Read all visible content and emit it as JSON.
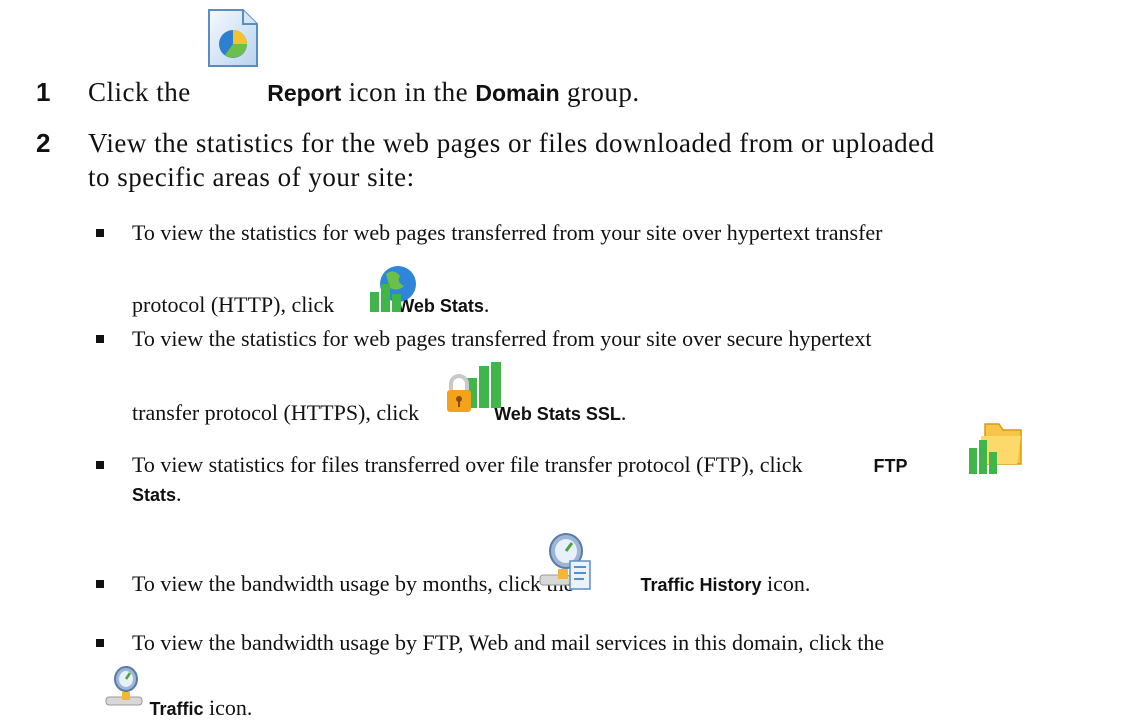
{
  "steps": [
    {
      "number": "1",
      "pre": "Click the",
      "icon": "report-icon",
      "label": "Report",
      "mid": "icon in the",
      "group": "Domain",
      "post": "group."
    },
    {
      "number": "2",
      "line1": "View the statistics for the web pages or files downloaded from or uploaded",
      "line2": "to specific areas of your site:"
    }
  ],
  "bullets": [
    {
      "line1": "To view the statistics for web pages transferred from your site over hypertext transfer",
      "line2_pre": "protocol (HTTP), click",
      "icon": "web-stats-icon",
      "label": "Web Stats",
      "post": "."
    },
    {
      "line1": "To view the statistics for web pages transferred from your site over secure hypertext",
      "line2_pre": "transfer protocol (HTTPS), click",
      "icon": "web-stats-ssl-icon",
      "label": "Web Stats SSL",
      "post": "."
    },
    {
      "line1_pre": "To view statistics for files transferred over file transfer protocol (FTP), click",
      "icon": "ftp-stats-icon",
      "label_a": "FTP",
      "label_b": "Stats",
      "post": "."
    },
    {
      "pre": "To view the bandwidth usage by months, click the",
      "icon": "traffic-history-icon",
      "label": "Traffic History",
      "post": "icon."
    },
    {
      "line1": "To view the bandwidth usage by FTP, Web and mail services in this domain, click the",
      "icon": "traffic-icon",
      "label": "Traffic",
      "post": "icon."
    }
  ]
}
